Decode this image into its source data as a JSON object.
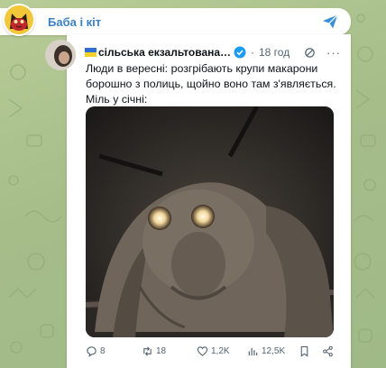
{
  "channel": {
    "name": "Баба і кіт"
  },
  "tweet": {
    "author_name": "сільська екзальтована жі...",
    "separator": "·",
    "time": "18 год",
    "more": "···",
    "lines": [
      "Люди в вересні: розгрібають крупи макарони",
      "борошно з полиць, щойно воно там з'являється.",
      "Міль у січні:"
    ],
    "stats": {
      "replies": "8",
      "reposts": "18",
      "likes": "1,2K",
      "views": "12,5K"
    }
  },
  "colors": {
    "channel_title": "#3b82c4",
    "share_blue": "#3a8fd9",
    "wallpaper": "#a9bf8e",
    "text": "#0f1419",
    "muted": "#536471"
  },
  "icons": [
    "channel-avatar-cat-icon",
    "share-forward-icon",
    "ukraine-flag-icon",
    "verified-badge-icon",
    "grok-icon",
    "more-dots-icon",
    "reply-icon",
    "repost-icon",
    "like-icon",
    "views-icon",
    "bookmark-icon",
    "share-icon"
  ]
}
